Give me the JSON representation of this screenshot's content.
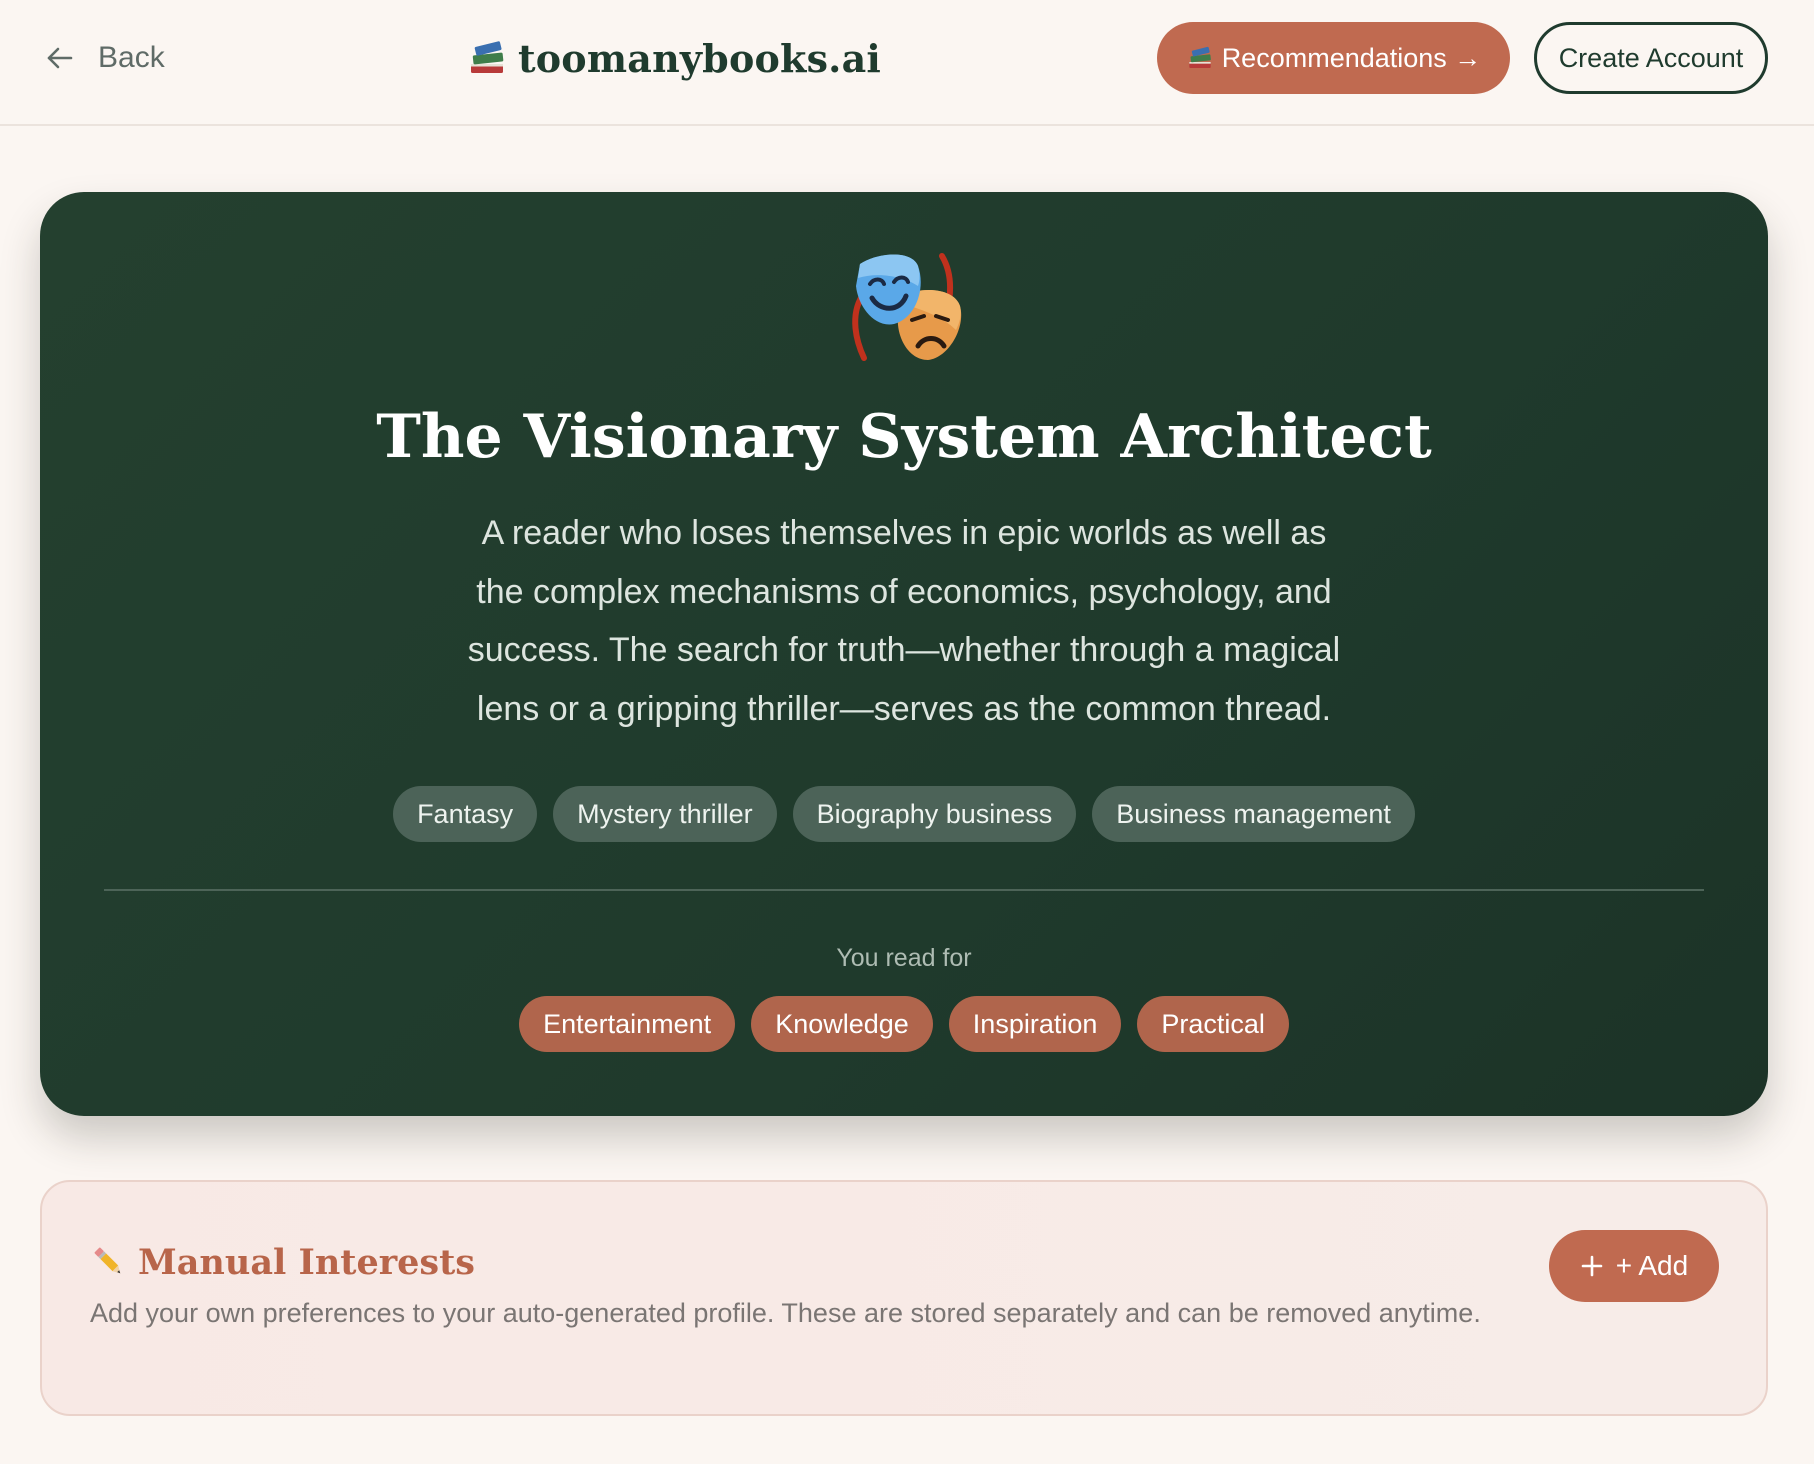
{
  "header": {
    "back_label": "Back",
    "brand": "toomanybooks.ai",
    "recommendations_label": "Recommendations →",
    "create_account_label": "Create Account"
  },
  "hero": {
    "icon": "performing-arts-masks-icon",
    "title": "The Visionary System Architect",
    "description": "A reader who loses themselves in epic worlds as well as the complex mechanisms of economics, psychology, and success. The search for truth—whether through a magical lens or a gripping thriller—serves as the common thread.",
    "genres": [
      "Fantasy",
      "Mystery thriller",
      "Biography business",
      "Business management"
    ],
    "read_for_label": "You read for",
    "purposes": [
      "Entertainment",
      "Knowledge",
      "Inspiration",
      "Practical"
    ]
  },
  "manual": {
    "icon": "pencil-icon",
    "title": "Manual Interests",
    "description": "Add your own preferences to your auto-generated profile. These are stored separately and can be removed anytime.",
    "add_label": "+ Add"
  },
  "colors": {
    "accent": "#c06a50",
    "dark_green": "#1f3b2e",
    "background": "#fbf6f2"
  }
}
